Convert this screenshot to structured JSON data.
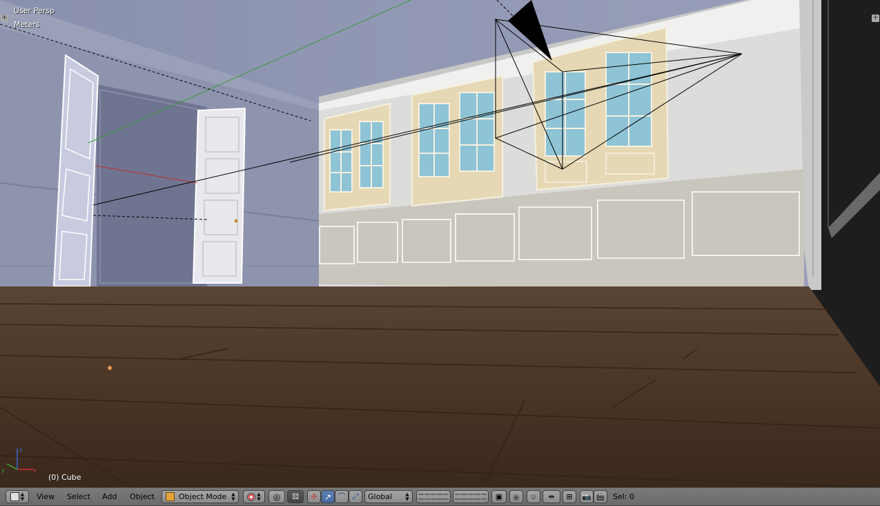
{
  "viewport": {
    "view_name": "User Persp",
    "units": "Meters",
    "object_info": "(0) Cube"
  },
  "header": {
    "menus": [
      "View",
      "Select",
      "Add",
      "Object"
    ],
    "mode_label": "Object Mode",
    "orientation_label": "Global",
    "selection_label": "Sel: 0"
  },
  "icons": {
    "editor_type": "3d-view-cube-icon",
    "mode": "object-mode-cube-icon",
    "shading": "viewport-shading-icon",
    "pivot": "pivot-point-icon",
    "manipulator": "manipulator-icon",
    "translate": "translate-arrow-icon",
    "rotate": "rotate-arc-icon",
    "scale": "scale-arrow-icon",
    "layers": "layers-grid-icon",
    "lock": "lock-layers-icon",
    "proportional": "proportional-edit-icon",
    "snap": "snap-magnet-icon",
    "snap_element": "snap-element-icon",
    "render": "render-camera-icon",
    "animation": "clapperboard-icon"
  },
  "colors": {
    "header_bg": "#727272",
    "active_blue": "#5276b3",
    "floor_wood": "#4a3426",
    "wall_white": "#e2e2e0",
    "window_frame": "#e6d8b4",
    "glass": "#8fc4d6"
  }
}
